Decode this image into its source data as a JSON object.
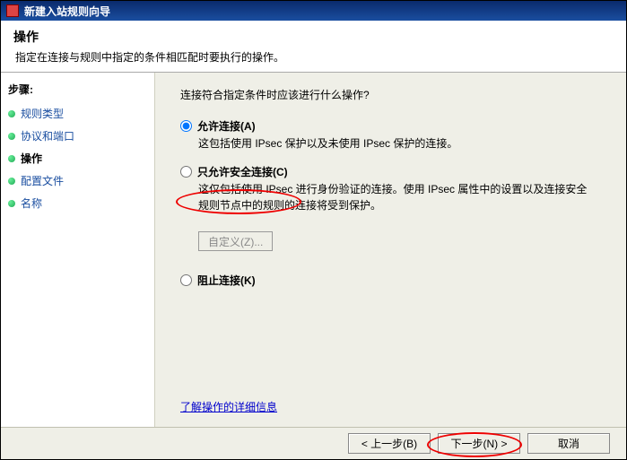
{
  "window": {
    "title": "新建入站规则向导"
  },
  "header": {
    "title": "操作",
    "subtitle": "指定在连接与规则中指定的条件相匹配时要执行的操作。"
  },
  "sidebar": {
    "heading": "步骤:",
    "items": [
      {
        "label": "规则类型"
      },
      {
        "label": "协议和端口"
      },
      {
        "label": "操作"
      },
      {
        "label": "配置文件"
      },
      {
        "label": "名称"
      }
    ],
    "current_index": 2
  },
  "content": {
    "prompt": "连接符合指定条件时应该进行什么操作?",
    "options": [
      {
        "id": "allow",
        "label": "允许连接(A)",
        "desc": "这包括使用 IPsec 保护以及未使用 IPsec 保护的连接。",
        "checked": true
      },
      {
        "id": "allow-secure",
        "label": "只允许安全连接(C)",
        "desc": "这仅包括使用 IPsec 进行身份验证的连接。使用 IPsec 属性中的设置以及连接安全规则节点中的规则的连接将受到保护。",
        "checked": false
      },
      {
        "id": "block",
        "label": "阻止连接(K)",
        "desc": "",
        "checked": false
      }
    ],
    "customize_label": "自定义(Z)...",
    "more_info": "了解操作的详细信息"
  },
  "footer": {
    "back": "< 上一步(B)",
    "next": "下一步(N) >",
    "cancel": "取消"
  }
}
